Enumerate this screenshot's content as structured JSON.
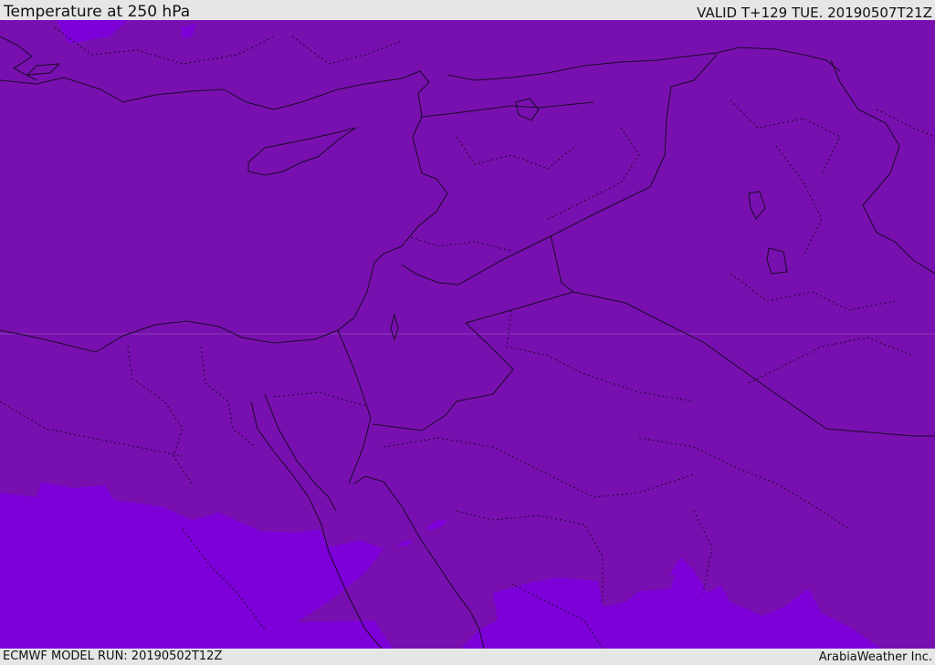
{
  "header": {
    "title": "Temperature at 250 hPa",
    "valid": "VALID T+129 TUE. 20190507T21Z"
  },
  "footer": {
    "model_run": "ECMWF MODEL RUN: 20190502T12Z",
    "credit": "ArabiaWeather Inc."
  },
  "map": {
    "region": "Eastern Mediterranean / Middle East",
    "field": "temperature",
    "level": "250 hPa",
    "colors": {
      "dominant_band": "#7810b0",
      "cold_band": "#7d00d9",
      "coastline": "#1a0a26",
      "borders": "#1a0a26"
    }
  }
}
